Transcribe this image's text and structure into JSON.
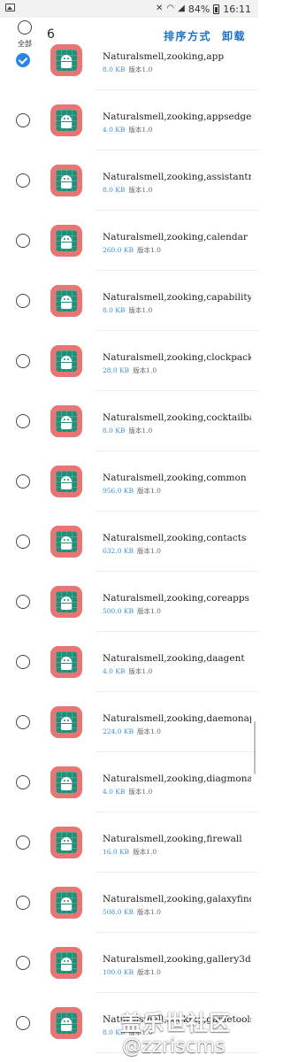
{
  "status_bar": {
    "battery": "84%",
    "time": "16:11",
    "icons": [
      "image-icon",
      "mute-icon",
      "wifi-icon",
      "signal-icon",
      "battery-icon"
    ]
  },
  "header": {
    "select_all_label": "全部",
    "selected_count": "6",
    "sort_label": "排序方式",
    "uninstall_label": "卸载"
  },
  "apps": [
    {
      "name": "Naturalsmell,zooking,app",
      "size": "8.0 KB",
      "version": "版本1.0",
      "checked": true
    },
    {
      "name": "Naturalsmell,zooking,appsedge",
      "size": "4.0 KB",
      "version": "版本1.0",
      "checked": false
    },
    {
      "name": "Naturalsmell,zooking,assistantme...",
      "size": "8.0 KB",
      "version": "版本1.0",
      "checked": false
    },
    {
      "name": "Naturalsmell,zooking,calendar",
      "size": "260.0 KB",
      "version": "版本1.0",
      "checked": false
    },
    {
      "name": "Naturalsmell,zooking,capabilitym...",
      "size": "8.0 KB",
      "version": "版本1.0",
      "checked": false
    },
    {
      "name": "Naturalsmell,zooking,clockpackage",
      "size": "28.0 KB",
      "version": "版本1.0",
      "checked": false
    },
    {
      "name": "Naturalsmell,zooking,cocktailbar...",
      "size": "8.0 KB",
      "version": "版本1.0",
      "checked": false
    },
    {
      "name": "Naturalsmell,zooking,common",
      "size": "956.0 KB",
      "version": "版本1.0",
      "checked": false
    },
    {
      "name": "Naturalsmell,zooking,contacts",
      "size": "632.0 KB",
      "version": "版本1.0",
      "checked": false
    },
    {
      "name": "Naturalsmell,zooking,coreapps",
      "size": "500.0 KB",
      "version": "版本1.0",
      "checked": false
    },
    {
      "name": "Naturalsmell,zooking,daagent",
      "size": "4.0 KB",
      "version": "版本1.0",
      "checked": false
    },
    {
      "name": "Naturalsmell,zooking,daemonapp",
      "size": "224.0 KB",
      "version": "版本1.0",
      "checked": false
    },
    {
      "name": "Naturalsmell,zooking,diagmonag...",
      "size": "4.0 KB",
      "version": "版本1.0",
      "checked": false
    },
    {
      "name": "Naturalsmell,zooking,firewall",
      "size": "16.0 KB",
      "version": "版本1.0",
      "checked": false
    },
    {
      "name": "Naturalsmell,zooking,galaxyfinder",
      "size": "508.0 KB",
      "version": "版本1.0",
      "checked": false
    },
    {
      "name": "Naturalsmell,zooking,gallery3d",
      "size": "100.0 KB",
      "version": "版本1.0",
      "checked": false
    },
    {
      "name": "Naturalsmell,zooking,gametools",
      "size": "8.0 KB",
      "version": "版本1.0",
      "checked": false
    }
  ],
  "watermark": {
    "line1": "盖乐世社区",
    "line2": "@zzriscms"
  },
  "colors": {
    "accent": "#1c73c4",
    "checkbox_checked": "#2a86e0",
    "size_text": "#3d8fd6",
    "app_icon_bg": "#e87474",
    "app_icon_inner": "#1e8f79"
  }
}
